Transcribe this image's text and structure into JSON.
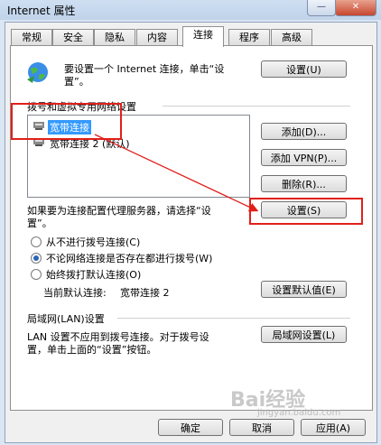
{
  "window": {
    "title": "Internet 属性",
    "minimize_glyph": "—",
    "close_glyph": "✕"
  },
  "tabs": [
    "常规",
    "安全",
    "隐私",
    "内容",
    "连接",
    "程序",
    "高级"
  ],
  "setup": {
    "text_line1": "要设置一个 Internet 连接，单击“设",
    "text_line2": "置”。",
    "button": "设置(U)"
  },
  "dialup": {
    "section_label": "拨号和虚拟专用网络设置",
    "items": [
      "宽带连接",
      "宽带连接 2 (默认)"
    ],
    "add_button": "添加(D)...",
    "add_vpn_button": "添加 VPN(P)...",
    "remove_button": "删除(R)...",
    "proxy_text_line1": "如果要为连接配置代理服务器，请选择“设",
    "proxy_text_line2": "置”。",
    "settings_button": "设置(S)",
    "radio_never": "从不进行拨号连接(C)",
    "radio_when_needed": "不论网络连接是否存在都进行拨号(W)",
    "radio_always": "始终拨打默认连接(O)",
    "current_default_label": "当前默认连接:",
    "current_default_value": "宽带连接 2",
    "set_default_button": "设置默认值(E)"
  },
  "lan": {
    "section_label": "局域网(LAN)设置",
    "text_line1": "LAN 设置不应用到拨号连接。对于拨号设",
    "text_line2": "置，单击上面的“设置”按钮。",
    "button": "局域网设置(L)"
  },
  "footer": {
    "ok": "确定",
    "cancel": "取消",
    "apply": "应用(A)"
  },
  "watermark": {
    "brand": "Bai经验",
    "url": "jingyan.baidu.com"
  },
  "colors": {
    "highlight_box": "#e0201a",
    "selection": "#3399ff"
  }
}
